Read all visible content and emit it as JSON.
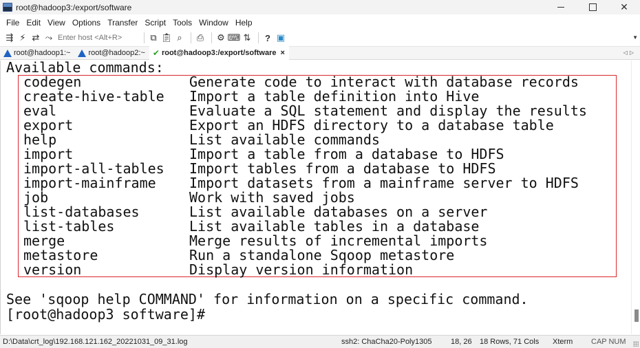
{
  "window": {
    "title": "root@hadoop3:/export/software"
  },
  "menu": [
    "File",
    "Edit",
    "View",
    "Options",
    "Transfer",
    "Script",
    "Tools",
    "Window",
    "Help"
  ],
  "toolbar": {
    "host_placeholder": "Enter host <Alt+R>"
  },
  "tabs": [
    {
      "label": "root@hadoop1:~",
      "icon": "warning-icon",
      "active": false
    },
    {
      "label": "root@hadoop2:~",
      "icon": "warning-icon",
      "active": false
    },
    {
      "label": "root@hadoop3:/export/software",
      "icon": "check-icon",
      "active": true
    }
  ],
  "tab_close": "×",
  "terminal": {
    "header": "Available commands:",
    "commands": [
      {
        "name": "codegen",
        "desc": "Generate code to interact with database records"
      },
      {
        "name": "create-hive-table",
        "desc": "Import a table definition into Hive"
      },
      {
        "name": "eval",
        "desc": "Evaluate a SQL statement and display the results"
      },
      {
        "name": "export",
        "desc": "Export an HDFS directory to a database table"
      },
      {
        "name": "help",
        "desc": "List available commands"
      },
      {
        "name": "import",
        "desc": "Import a table from a database to HDFS"
      },
      {
        "name": "import-all-tables",
        "desc": "Import tables from a database to HDFS"
      },
      {
        "name": "import-mainframe",
        "desc": "Import datasets from a mainframe server to HDFS"
      },
      {
        "name": "job",
        "desc": "Work with saved jobs"
      },
      {
        "name": "list-databases",
        "desc": "List available databases on a server"
      },
      {
        "name": "list-tables",
        "desc": "List available tables in a database"
      },
      {
        "name": "merge",
        "desc": "Merge results of incremental imports"
      },
      {
        "name": "metastore",
        "desc": "Run a standalone Sqoop metastore"
      },
      {
        "name": "version",
        "desc": "Display version information"
      }
    ],
    "footer": "See 'sqoop help COMMAND' for information on a specific command.",
    "prompt": "[root@hadoop3 software]#"
  },
  "statusbar": {
    "log_path": "D:\\Data\\crt_log\\192.168.121.162_20221031_09_31.log",
    "cipher": "ssh2: ChaCha20-Poly1305",
    "cursor_pos": "18, 26",
    "size": "18 Rows, 71 Cols",
    "term_type": "Xterm",
    "keys": "CAP NUM"
  },
  "colors": {
    "highlight_border": "#d9262b",
    "tab_warning": "#1e63c4",
    "tab_ok": "#2aa52a"
  }
}
